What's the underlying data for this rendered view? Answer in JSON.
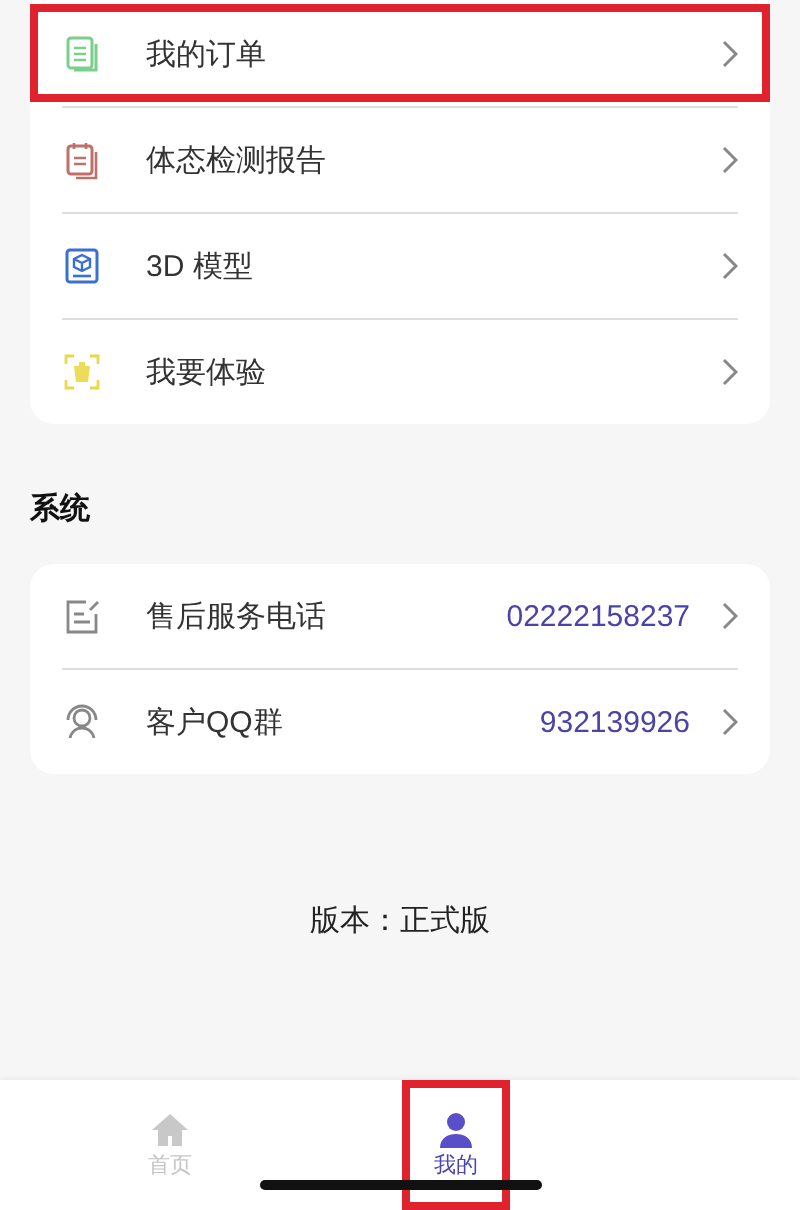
{
  "menu": [
    {
      "label": "我的订单",
      "highlighted": true
    },
    {
      "label": "体态检测报告",
      "highlighted": false
    },
    {
      "label": "3D 模型",
      "highlighted": false
    },
    {
      "label": "我要体验",
      "highlighted": false
    }
  ],
  "system": {
    "title": "系统",
    "items": [
      {
        "label": "售后服务电话",
        "value": "02222158237"
      },
      {
        "label": "客户QQ群",
        "value": "932139926"
      }
    ]
  },
  "version": "版本：正式版",
  "tabs": [
    {
      "label": "首页",
      "selected": false,
      "highlighted": false
    },
    {
      "label": "我的",
      "selected": true,
      "highlighted": true
    }
  ]
}
